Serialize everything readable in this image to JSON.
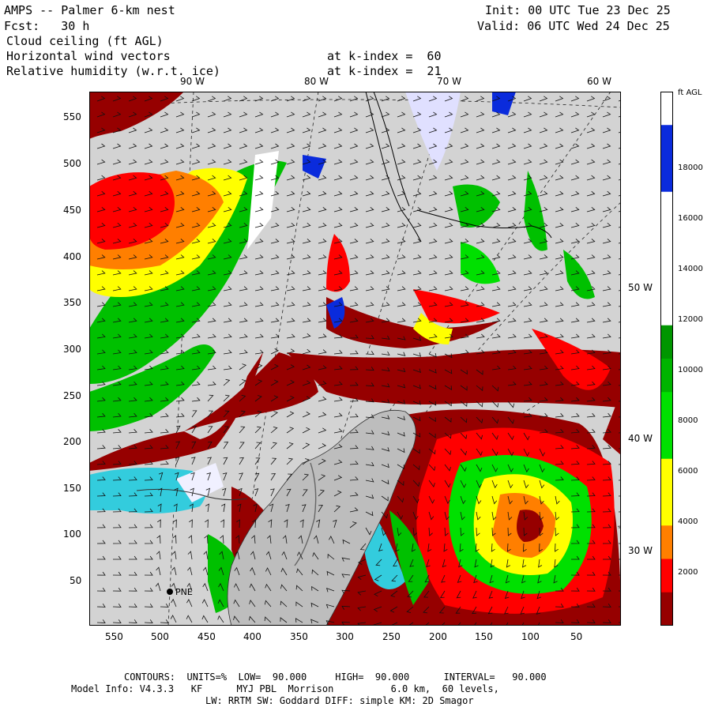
{
  "header": {
    "model_line": "AMPS -- Palmer 6-km nest",
    "fcst_line": "Fcst:   30 h",
    "init_line": "Init: 00 UTC Tue 23 Dec 25",
    "valid_line": "Valid: 06 UTC Wed 24 Dec 25",
    "field1": "Cloud ceiling (ft AGL)",
    "field2": "Horizontal wind vectors",
    "field3": "Relative humidity (w.r.t. ice)",
    "kindex2": "at k-index =  60",
    "kindex3": "at k-index =  21"
  },
  "top_lon_labels": [
    "90 W",
    "80 W",
    "70 W",
    "60 W"
  ],
  "right_lon_labels": [
    "50 W",
    "40 W",
    "30 W"
  ],
  "y_ticks": [
    "550",
    "500",
    "450",
    "400",
    "350",
    "300",
    "250",
    "200",
    "150",
    "100",
    "50"
  ],
  "x_ticks": [
    "550",
    "500",
    "450",
    "400",
    "350",
    "300",
    "250",
    "200",
    "150",
    "100",
    "50"
  ],
  "station_label": "PNE",
  "colorbar": {
    "unit": "ft AGL",
    "labels": [
      "18000",
      "16000",
      "14000",
      "12000",
      "10000",
      "8000",
      "6000",
      "4000",
      "2000"
    ],
    "colors": [
      "#ffffff",
      "#0a2bdc",
      "#0a2bdc",
      "#ffffff",
      "#ffffff",
      "#ffffff",
      "#ffffff",
      "#009600",
      "#00b400",
      "#00e000",
      "#00e000",
      "#ffff00",
      "#ffff00",
      "#ff7f00",
      "#ff0000",
      "#960000"
    ]
  },
  "footer": {
    "line1": "CONTOURS:  UNITS=%  LOW=  90.000     HIGH=  90.000      INTERVAL=   90.000",
    "line2": "Model Info: V4.3.3   KF      MYJ PBL  Morrison          6.0 km,  60 levels,",
    "line3": "LW: RRTM SW: Goddard DIFF: simple KM: 2D Smagor"
  }
}
